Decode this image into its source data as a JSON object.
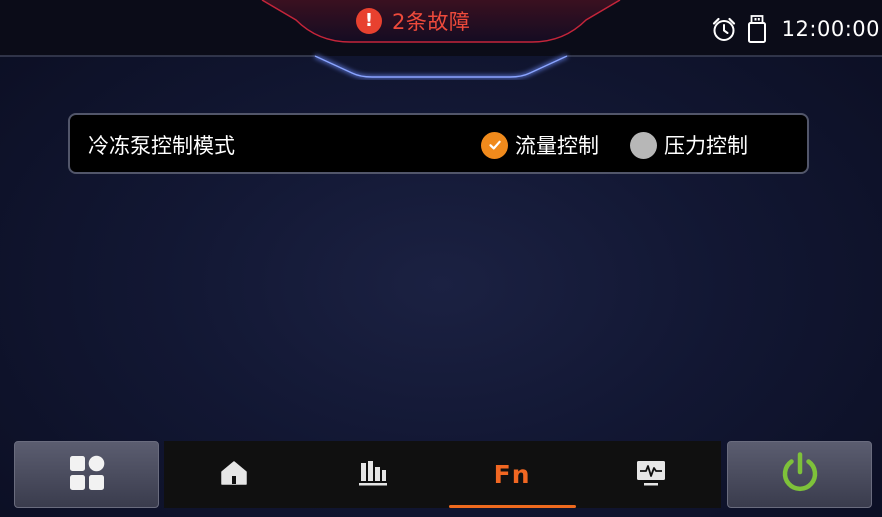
{
  "header": {
    "fault_text": "2条故障",
    "time": "12:00:00",
    "colors": {
      "alert": "#e8412f",
      "accent_glow": "#6f8fff"
    },
    "icons": [
      "alert-exclamation-icon",
      "alarm-clock-icon",
      "usb-drive-icon"
    ]
  },
  "setting": {
    "label": "冷冻泵控制模式",
    "options": [
      {
        "label": "流量控制",
        "selected": true
      },
      {
        "label": "压力控制",
        "selected": false
      }
    ],
    "colors": {
      "selected": "#f08a1c",
      "unselected": "#b7b7b7"
    }
  },
  "bottom_nav": {
    "fn_label": "Fn",
    "active_tab": "Fn",
    "icons": [
      "apps-grid-icon",
      "home-icon",
      "bar-chart-icon",
      "monitor-waveform-icon",
      "power-icon"
    ],
    "colors": {
      "active": "#f16722",
      "power": "#7ec23a"
    }
  }
}
